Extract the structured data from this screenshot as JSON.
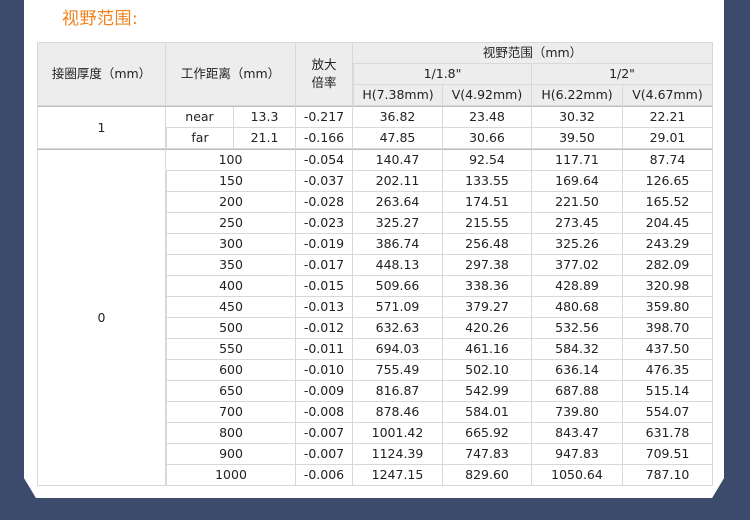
{
  "heading": "视野范围:",
  "table": {
    "header": {
      "col_thickness": "接圈厚度（mm）",
      "col_distance": "工作距离（mm）",
      "col_mag_line1": "放大",
      "col_mag_line2": "倍率",
      "col_fov": "视野范围（mm）",
      "sensor_a": "1/1.8\"",
      "sensor_b": "1/2\"",
      "h_a": "H(7.38mm)",
      "v_a": "V(4.92mm)",
      "h_b": "H(6.22mm)",
      "v_b": "V(4.67mm)"
    },
    "group1": {
      "thickness": "1",
      "rows": [
        {
          "label": "near",
          "distance": "13.3",
          "mag": "-0.217",
          "h_a": "36.82",
          "v_a": "23.48",
          "h_b": "30.32",
          "v_b": "22.21"
        },
        {
          "label": "far",
          "distance": "21.1",
          "mag": "-0.166",
          "h_a": "47.85",
          "v_a": "30.66",
          "h_b": "39.50",
          "v_b": "29.01"
        }
      ]
    },
    "group0": {
      "thickness": "0",
      "rows": [
        {
          "distance": "100",
          "mag": "-0.054",
          "h_a": "140.47",
          "v_a": "92.54",
          "h_b": "117.71",
          "v_b": "87.74"
        },
        {
          "distance": "150",
          "mag": "-0.037",
          "h_a": "202.11",
          "v_a": "133.55",
          "h_b": "169.64",
          "v_b": "126.65"
        },
        {
          "distance": "200",
          "mag": "-0.028",
          "h_a": "263.64",
          "v_a": "174.51",
          "h_b": "221.50",
          "v_b": "165.52"
        },
        {
          "distance": "250",
          "mag": "-0.023",
          "h_a": "325.27",
          "v_a": "215.55",
          "h_b": "273.45",
          "v_b": "204.45"
        },
        {
          "distance": "300",
          "mag": "-0.019",
          "h_a": "386.74",
          "v_a": "256.48",
          "h_b": "325.26",
          "v_b": "243.29"
        },
        {
          "distance": "350",
          "mag": "-0.017",
          "h_a": "448.13",
          "v_a": "297.38",
          "h_b": "377.02",
          "v_b": "282.09"
        },
        {
          "distance": "400",
          "mag": "-0.015",
          "h_a": "509.66",
          "v_a": "338.36",
          "h_b": "428.89",
          "v_b": "320.98"
        },
        {
          "distance": "450",
          "mag": "-0.013",
          "h_a": "571.09",
          "v_a": "379.27",
          "h_b": "480.68",
          "v_b": "359.80"
        },
        {
          "distance": "500",
          "mag": "-0.012",
          "h_a": "632.63",
          "v_a": "420.26",
          "h_b": "532.56",
          "v_b": "398.70"
        },
        {
          "distance": "550",
          "mag": "-0.011",
          "h_a": "694.03",
          "v_a": "461.16",
          "h_b": "584.32",
          "v_b": "437.50"
        },
        {
          "distance": "600",
          "mag": "-0.010",
          "h_a": "755.49",
          "v_a": "502.10",
          "h_b": "636.14",
          "v_b": "476.35"
        },
        {
          "distance": "650",
          "mag": "-0.009",
          "h_a": "816.87",
          "v_a": "542.99",
          "h_b": "687.88",
          "v_b": "515.14"
        },
        {
          "distance": "700",
          "mag": "-0.008",
          "h_a": "878.46",
          "v_a": "584.01",
          "h_b": "739.80",
          "v_b": "554.07"
        },
        {
          "distance": "800",
          "mag": "-0.007",
          "h_a": "1001.42",
          "v_a": "665.92",
          "h_b": "843.47",
          "v_b": "631.78"
        },
        {
          "distance": "900",
          "mag": "-0.007",
          "h_a": "1124.39",
          "v_a": "747.83",
          "h_b": "947.83",
          "v_b": "709.51"
        },
        {
          "distance": "1000",
          "mag": "-0.006",
          "h_a": "1247.15",
          "v_a": "829.60",
          "h_b": "1050.64",
          "v_b": "787.10"
        }
      ]
    }
  }
}
